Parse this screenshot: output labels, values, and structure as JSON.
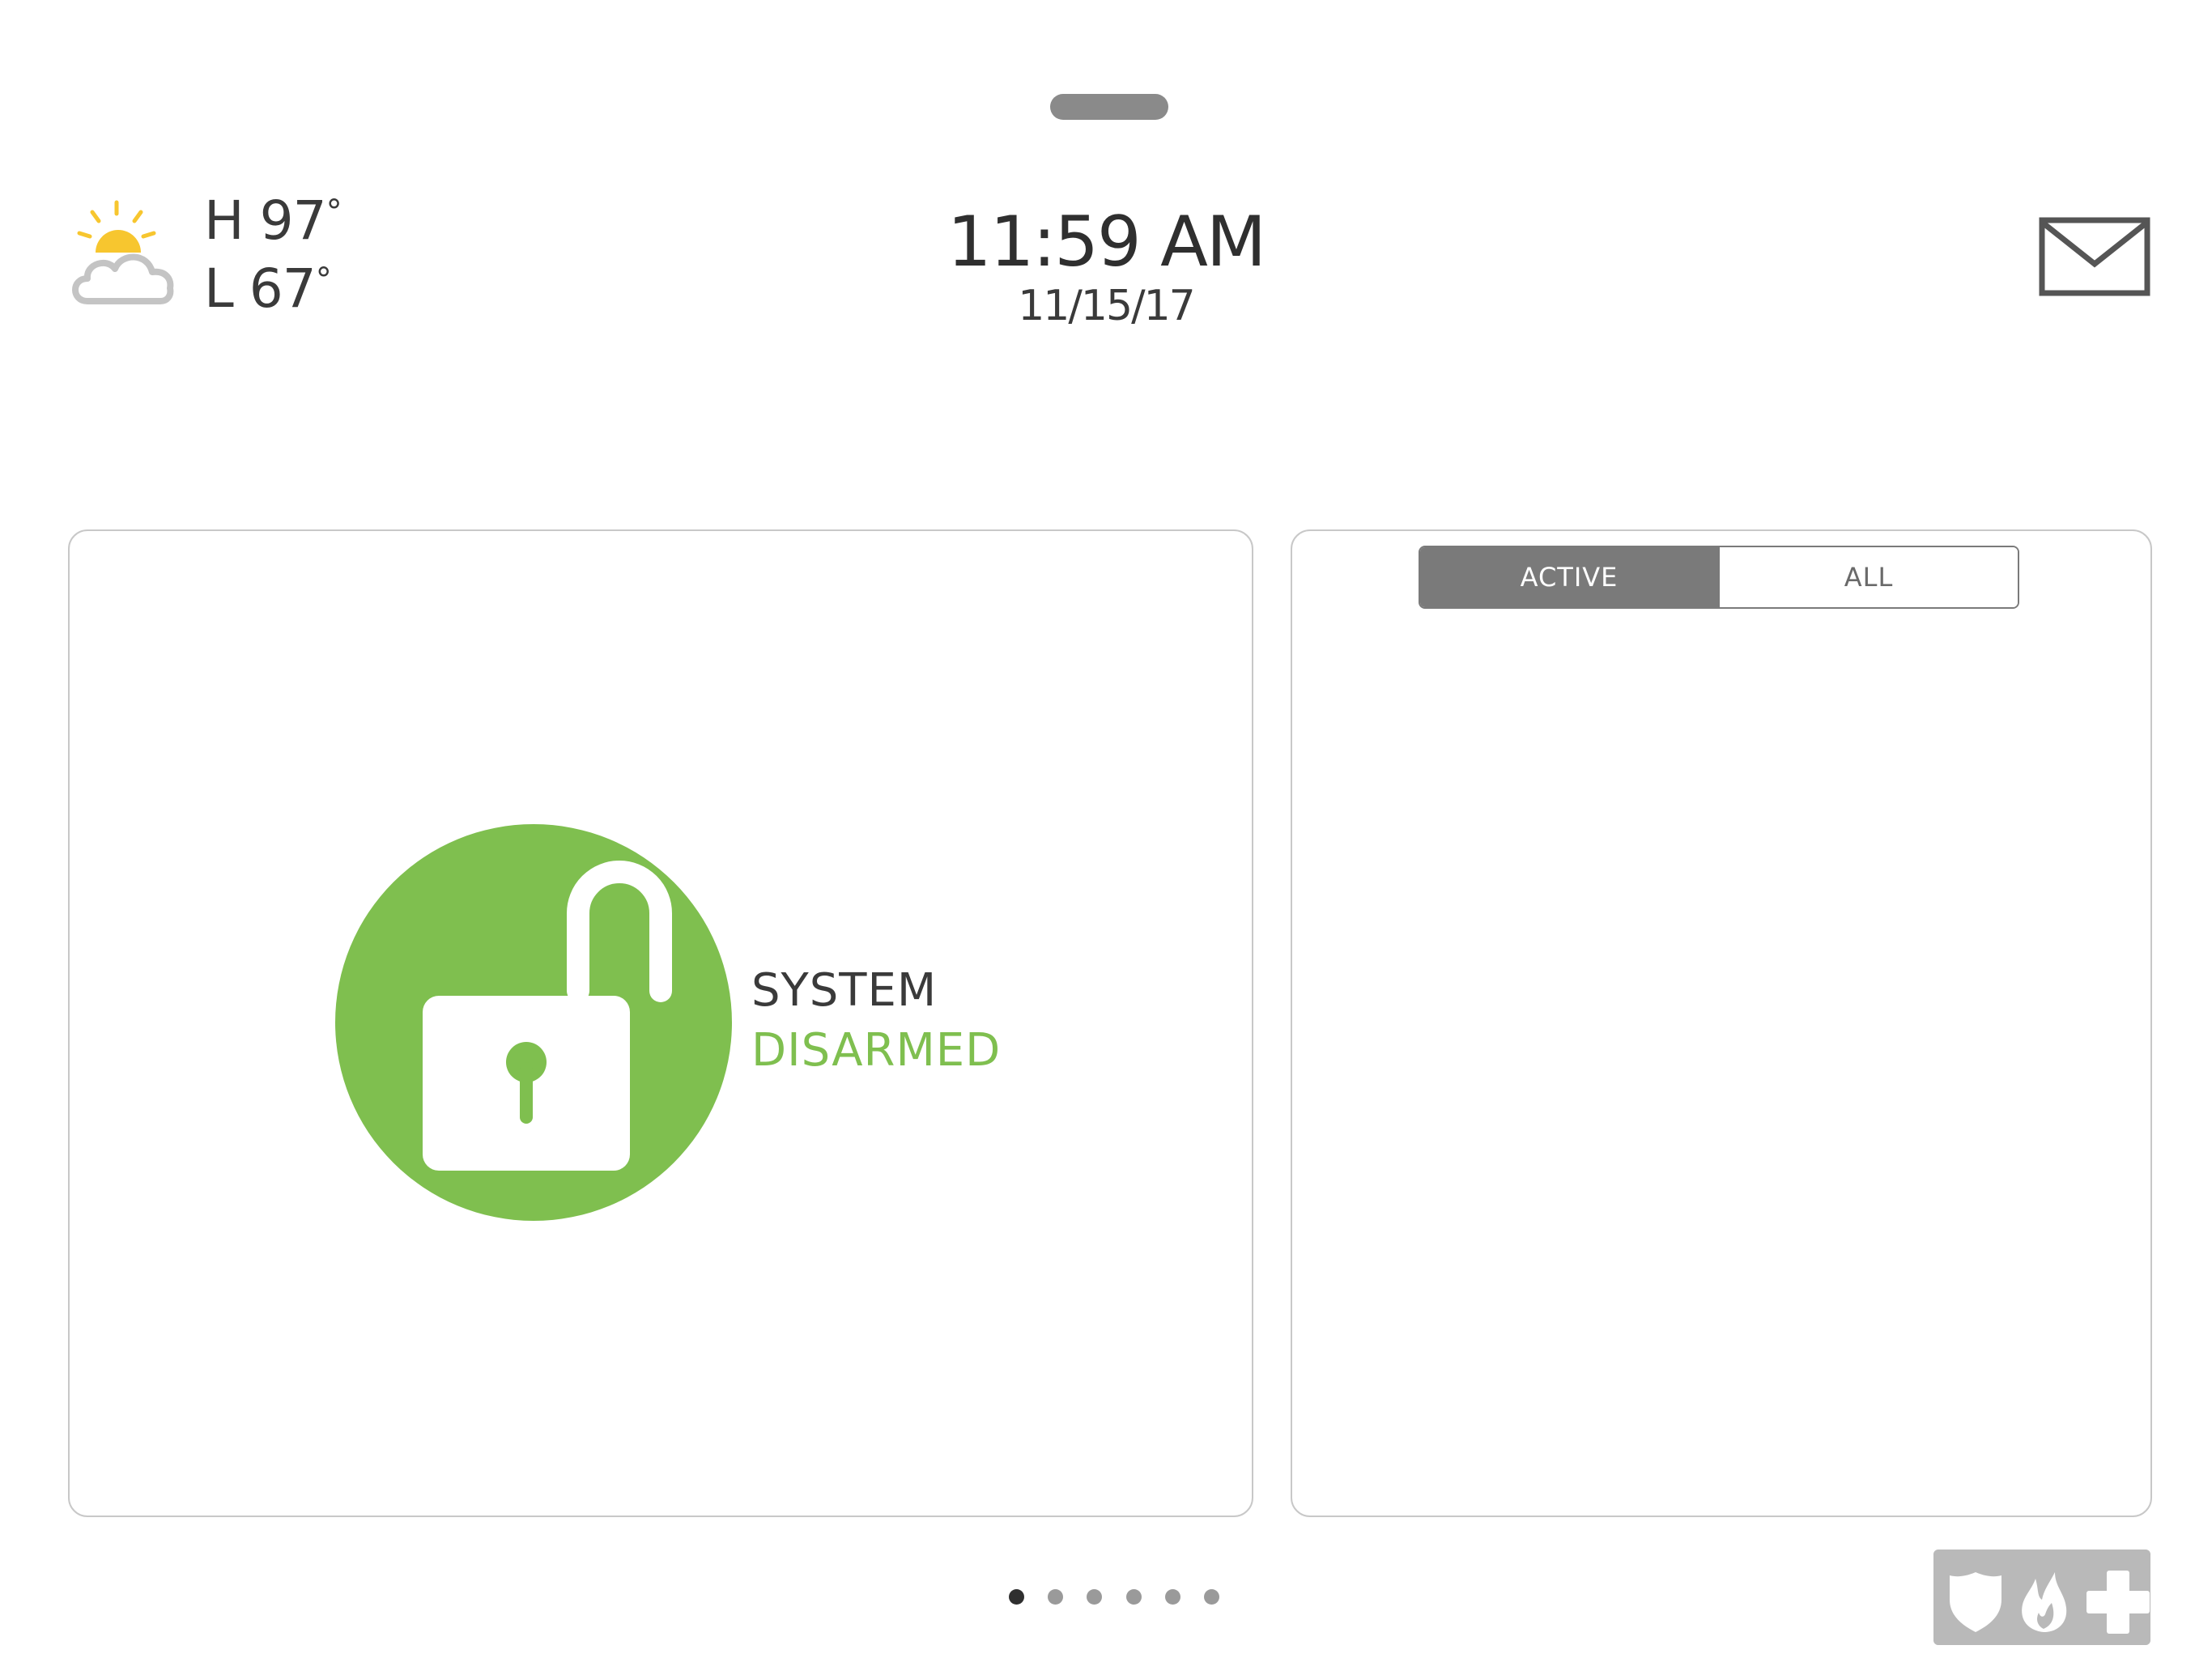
{
  "weather": {
    "high_label": "H 97",
    "low_label": "L 67",
    "degree_symbol": "°",
    "icon": "partly-sunny-icon"
  },
  "clock": {
    "time": "11:59 AM",
    "date": "11/15/17"
  },
  "header": {
    "messages_icon": "envelope-icon"
  },
  "status": {
    "line1": "SYSTEM",
    "line2": "DISARMED",
    "icon": "unlocked-padlock-icon",
    "color": "#7fbf4f"
  },
  "filter": {
    "tabs": [
      {
        "label": "ACTIVE",
        "selected": true
      },
      {
        "label": "ALL",
        "selected": false
      }
    ]
  },
  "pager": {
    "page_count": 6,
    "current_page": 1
  },
  "emergency": {
    "icons": [
      "shield-icon",
      "fire-icon",
      "medical-cross-icon"
    ]
  },
  "colors": {
    "accent_green": "#7fbf4f",
    "sun_yellow": "#f7c62f",
    "ui_gray": "#7a7a7a"
  }
}
